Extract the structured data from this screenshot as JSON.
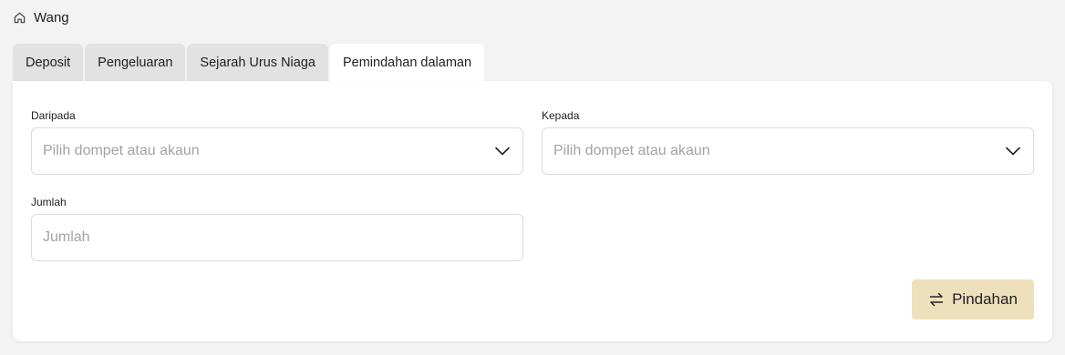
{
  "breadcrumb": {
    "icon": "home-icon",
    "label": "Wang"
  },
  "tabs": [
    {
      "label": "Deposit",
      "active": false
    },
    {
      "label": "Pengeluaran",
      "active": false
    },
    {
      "label": "Sejarah Urus Niaga",
      "active": false
    },
    {
      "label": "Pemindahan dalaman",
      "active": true
    }
  ],
  "form": {
    "from": {
      "label": "Daripada",
      "placeholder": "Pilih dompet atau akaun",
      "icon": "chevron-down-icon"
    },
    "to": {
      "label": "Kepada",
      "placeholder": "Pilih dompet atau akaun",
      "icon": "chevron-down-icon"
    },
    "amount": {
      "label": "Jumlah",
      "placeholder": "Jumlah",
      "value": ""
    },
    "submit": {
      "label": "Pindahan",
      "icon": "transfer-arrows-icon"
    }
  },
  "colors": {
    "accent_button": "#efe0bd",
    "background": "#f3f3f3",
    "active_tab": "#ffffff",
    "inactive_tab": "#e2e2e2"
  }
}
